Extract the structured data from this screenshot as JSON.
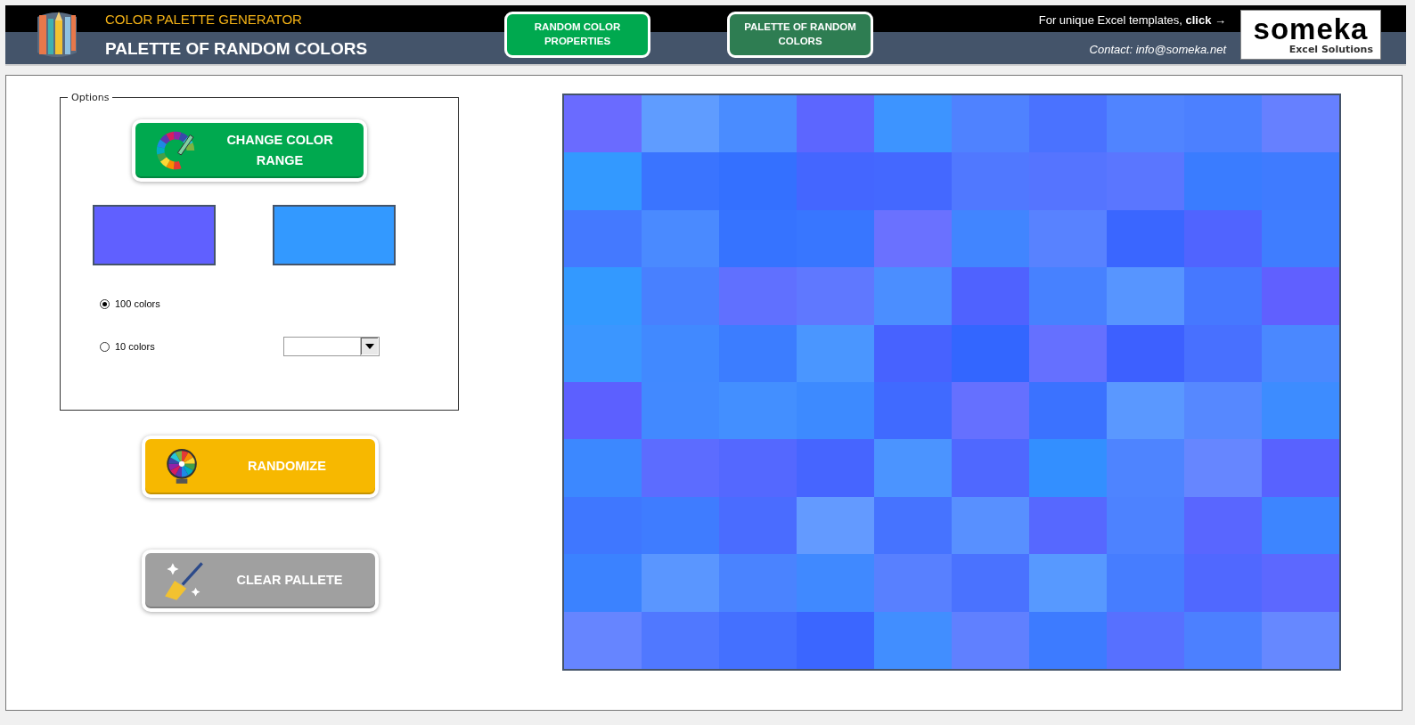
{
  "header": {
    "app_title": "COLOR PALETTE GENERATOR",
    "page_title": "PALETTE OF RANDOM COLORS",
    "nav_buttons": [
      {
        "label": "RANDOM COLOR PROPERTIES",
        "selected": false
      },
      {
        "label": "PALETTE OF RANDOM COLORS",
        "selected": true
      }
    ],
    "promo": {
      "text": "For unique Excel templates, ",
      "link": "click →"
    },
    "contact": "Contact: info@someka.net",
    "brand": {
      "name": "someka",
      "tagline": "Excel Solutions"
    }
  },
  "options": {
    "legend": "Options",
    "change_button": "CHANGE COLOR RANGE",
    "range_swatches": [
      {
        "color": "#6060ff"
      },
      {
        "color": "#3399ff"
      }
    ],
    "radios": [
      {
        "label": "100 colors",
        "selected": true
      },
      {
        "label": "10 colors",
        "selected": false
      }
    ]
  },
  "actions": [
    {
      "kind": "randomize",
      "label": "RANDOMIZE"
    },
    {
      "kind": "clear",
      "label": "CLEAR PALLETE"
    }
  ],
  "palette": [
    [
      {
        "color": "#6a6bff"
      },
      {
        "color": "#5f9cff"
      },
      {
        "color": "#4a8cff"
      },
      {
        "color": "#5c66ff"
      },
      {
        "color": "#3d94ff"
      },
      {
        "color": "#4f82ff"
      },
      {
        "color": "#4a72ff"
      },
      {
        "color": "#5084ff"
      },
      {
        "color": "#4c80ff"
      },
      {
        "color": "#6680ff"
      }
    ],
    [
      {
        "color": "#3399ff"
      },
      {
        "color": "#3a74ff"
      },
      {
        "color": "#3470ff"
      },
      {
        "color": "#4466ff"
      },
      {
        "color": "#4468ff"
      },
      {
        "color": "#5078ff"
      },
      {
        "color": "#5574ff"
      },
      {
        "color": "#5a76ff"
      },
      {
        "color": "#3a7cff"
      },
      {
        "color": "#3f7bff"
      }
    ],
    [
      {
        "color": "#4479ff"
      },
      {
        "color": "#4a8aff"
      },
      {
        "color": "#3673ff"
      },
      {
        "color": "#3876ff"
      },
      {
        "color": "#6a71ff"
      },
      {
        "color": "#4185ff"
      },
      {
        "color": "#5882ff"
      },
      {
        "color": "#3a66ff"
      },
      {
        "color": "#5064ff"
      },
      {
        "color": "#3f7dff"
      }
    ],
    [
      {
        "color": "#3399ff"
      },
      {
        "color": "#4880ff"
      },
      {
        "color": "#6070ff"
      },
      {
        "color": "#5f78ff"
      },
      {
        "color": "#4b8eff"
      },
      {
        "color": "#4f62ff"
      },
      {
        "color": "#4781ff"
      },
      {
        "color": "#5795ff"
      },
      {
        "color": "#4678ff"
      },
      {
        "color": "#6060ff"
      }
    ],
    [
      {
        "color": "#3b96ff"
      },
      {
        "color": "#4189ff"
      },
      {
        "color": "#3c7dff"
      },
      {
        "color": "#4a96ff"
      },
      {
        "color": "#4762ff"
      },
      {
        "color": "#3366ff"
      },
      {
        "color": "#6570ff"
      },
      {
        "color": "#3d60ff"
      },
      {
        "color": "#4870ff"
      },
      {
        "color": "#4a88ff"
      }
    ],
    [
      {
        "color": "#5c60ff"
      },
      {
        "color": "#4289ff"
      },
      {
        "color": "#438fff"
      },
      {
        "color": "#3d8aff"
      },
      {
        "color": "#406aff"
      },
      {
        "color": "#6570ff"
      },
      {
        "color": "#3b72ff"
      },
      {
        "color": "#5a98ff"
      },
      {
        "color": "#5688ff"
      },
      {
        "color": "#3d8cff"
      }
    ],
    [
      {
        "color": "#3c88ff"
      },
      {
        "color": "#5c6cff"
      },
      {
        "color": "#5468ff"
      },
      {
        "color": "#4665ff"
      },
      {
        "color": "#4b94ff"
      },
      {
        "color": "#4f68ff"
      },
      {
        "color": "#338fff"
      },
      {
        "color": "#4e84ff"
      },
      {
        "color": "#6686ff"
      },
      {
        "color": "#5862ff"
      }
    ],
    [
      {
        "color": "#3f77ff"
      },
      {
        "color": "#3f7cff"
      },
      {
        "color": "#4a6cff"
      },
      {
        "color": "#639aff"
      },
      {
        "color": "#4673ff"
      },
      {
        "color": "#5890ff"
      },
      {
        "color": "#5668ff"
      },
      {
        "color": "#4d82ff"
      },
      {
        "color": "#5966ff"
      },
      {
        "color": "#3d85ff"
      }
    ],
    [
      {
        "color": "#3b82ff"
      },
      {
        "color": "#5a96ff"
      },
      {
        "color": "#4a83ff"
      },
      {
        "color": "#4089ff"
      },
      {
        "color": "#5880ff"
      },
      {
        "color": "#4a72ff"
      },
      {
        "color": "#5799ff"
      },
      {
        "color": "#467dff"
      },
      {
        "color": "#5068ff"
      },
      {
        "color": "#5c68ff"
      }
    ],
    [
      {
        "color": "#6685ff"
      },
      {
        "color": "#5078ff"
      },
      {
        "color": "#4470ff"
      },
      {
        "color": "#3b66ff"
      },
      {
        "color": "#418eff"
      },
      {
        "color": "#6080ff"
      },
      {
        "color": "#3d7bff"
      },
      {
        "color": "#5770ff"
      },
      {
        "color": "#4c80ff"
      },
      {
        "color": "#6688ff"
      }
    ]
  ]
}
